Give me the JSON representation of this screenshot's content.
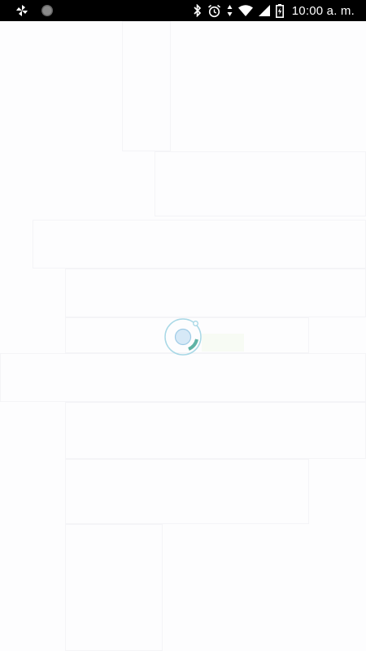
{
  "status_bar": {
    "time": "10:00 a. m.",
    "icons": [
      "pinwheel-icon",
      "circle-dot-icon",
      "bluetooth-icon",
      "alarm-icon",
      "data-arrows-icon",
      "wifi-icon",
      "signal-icon",
      "battery-charging-icon"
    ]
  },
  "loading": {
    "spinner_icon": "loading-spinner-icon",
    "colors": {
      "ring": "#a8d8e6",
      "core": "#cfe6f5",
      "arc": "#5fb3a6",
      "dot": "#a8d8e6"
    }
  }
}
